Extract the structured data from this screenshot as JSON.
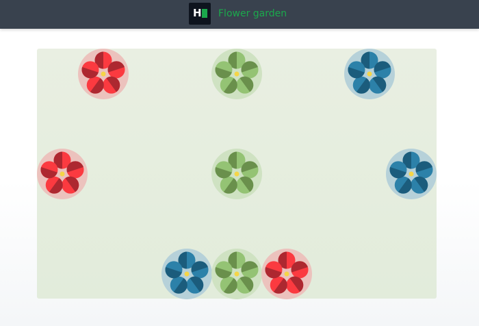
{
  "header": {
    "logo_letter": "H",
    "title": "Flower garden"
  },
  "colors": {
    "header_bg": "#39424e",
    "brand_green": "#1ba94c",
    "garden_bg": "#e6eddf",
    "center": "#f5d547"
  },
  "palettes": {
    "red": {
      "halo": "#ecc2bd",
      "light": "#fb3a40",
      "dark": "#ad2830"
    },
    "green": {
      "halo": "#cfe2c2",
      "light": "#94c374",
      "dark": "#6a904c"
    },
    "blue": {
      "halo": "#b6d1d9",
      "light": "#2c81a9",
      "dark": "#1b5c7c"
    }
  },
  "garden": {
    "flowers": [
      {
        "color": "red"
      },
      {
        "color": "green"
      },
      {
        "color": "blue"
      },
      {
        "color": "red"
      },
      {
        "color": "green"
      },
      {
        "color": "blue"
      },
      {
        "color": "blue"
      },
      {
        "color": "green"
      },
      {
        "color": "red"
      }
    ]
  }
}
